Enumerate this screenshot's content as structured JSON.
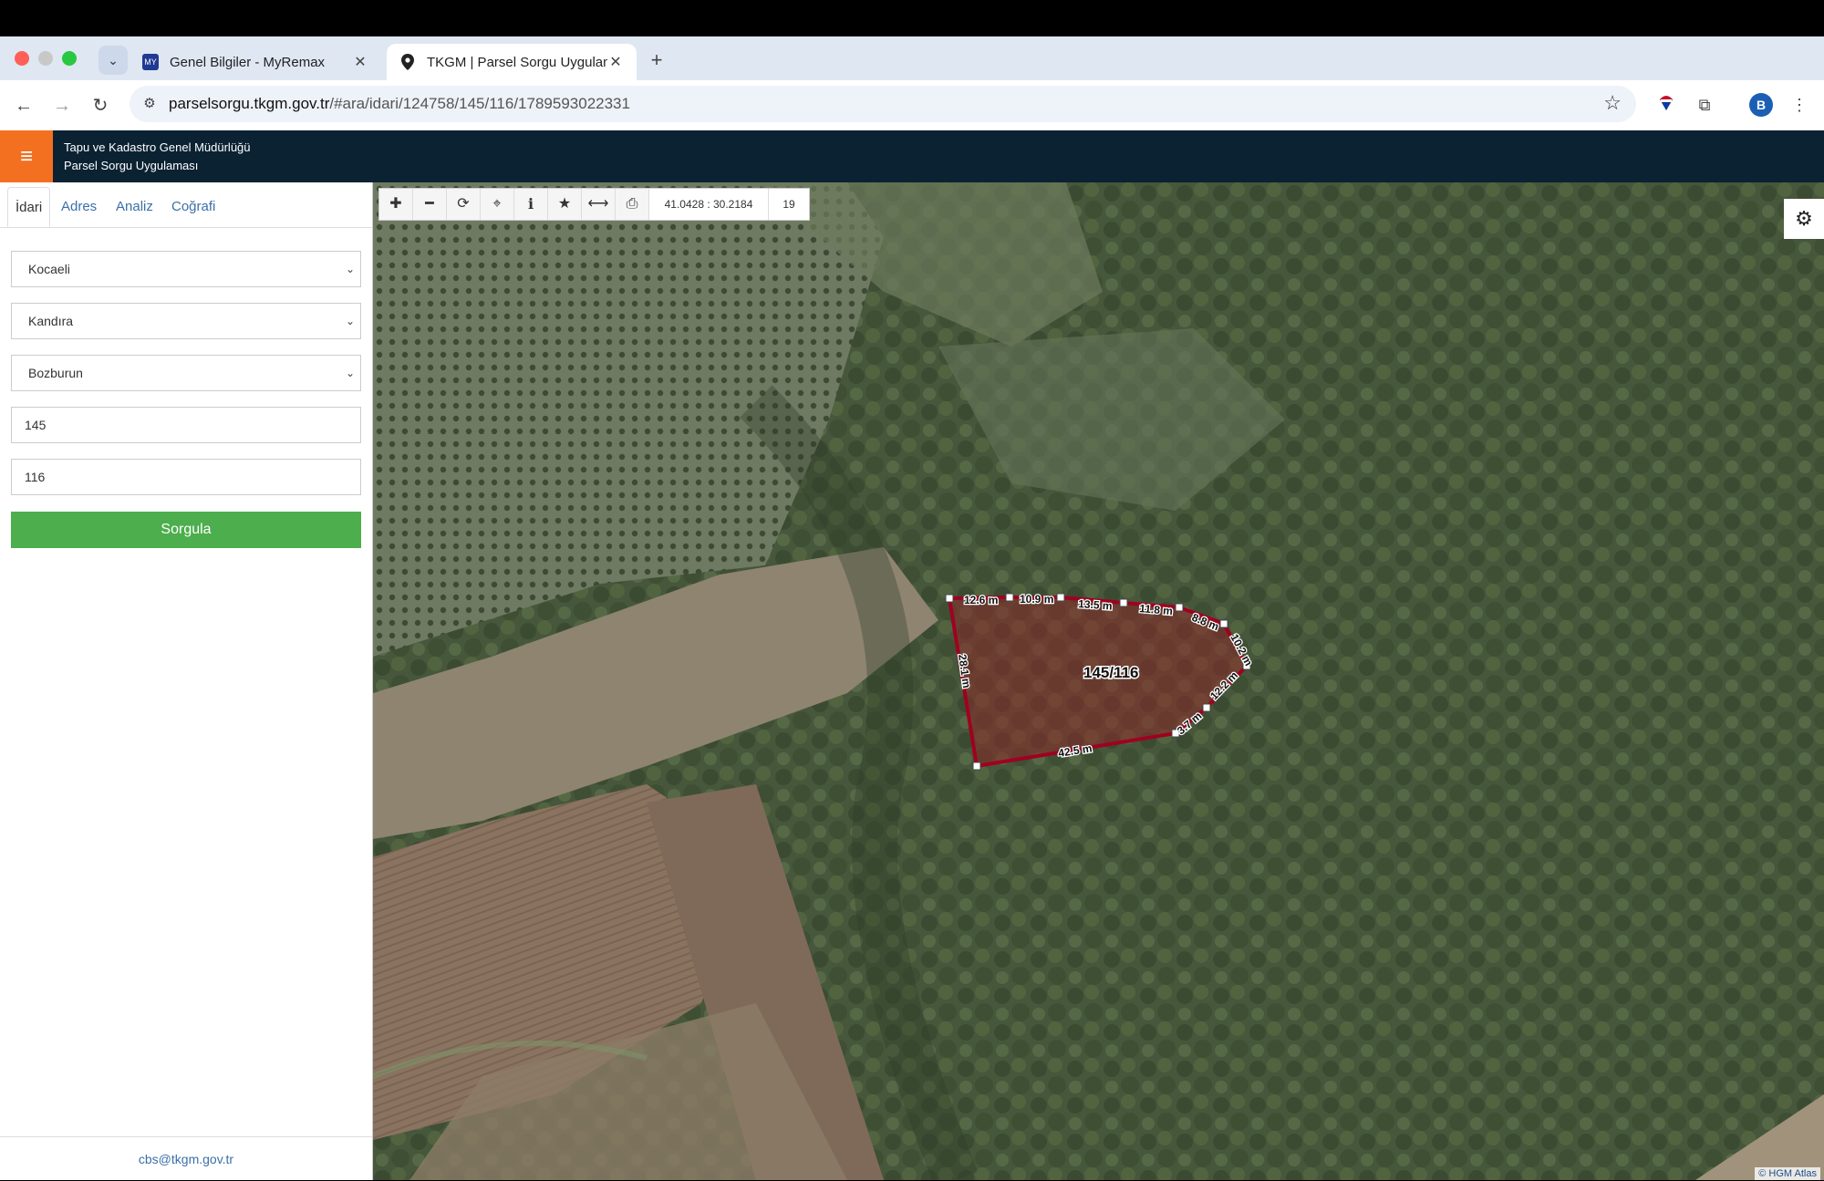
{
  "browser": {
    "tabs": [
      {
        "title": "Genel Bilgiler - MyRemax",
        "favicon": "remax-icon"
      },
      {
        "title": "TKGM | Parsel Sorgu Uygulam",
        "favicon": "location-pin-icon"
      }
    ],
    "url_host": "parselsorgu.tkgm.gov.tr",
    "url_path": "/#ara/idari/124758/145/116/1789593022331",
    "profile_initial": "B"
  },
  "app": {
    "title_line1": "Tapu ve Kadastro Genel Müdürlüğü",
    "title_line2": "Parsel Sorgu Uygulaması"
  },
  "sidebar": {
    "tabs": [
      "İdari",
      "Adres",
      "Analiz",
      "Coğrafi"
    ],
    "active_tab": "İdari",
    "province": "Kocaeli",
    "district": "Kandıra",
    "neighborhood": "Bozburun",
    "ada": "145",
    "parsel": "116",
    "query_button": "Sorgula",
    "footer_email": "cbs@tkgm.gov.tr"
  },
  "map": {
    "coordinates": "41.0428 : 30.2184",
    "zoom": "19",
    "parcel_label": "145/116",
    "parcel_fill": "#8b2a2a",
    "parcel_stroke": "#a00020",
    "edge_labels": [
      "12.6 m",
      "10.9 m",
      "13.5 m",
      "11.8 m",
      "8.8 m",
      "10.2 m",
      "12.2 m",
      "3.7 m",
      "42.5 m",
      "28.1 m"
    ],
    "attribution": "© HGM Atlas"
  }
}
